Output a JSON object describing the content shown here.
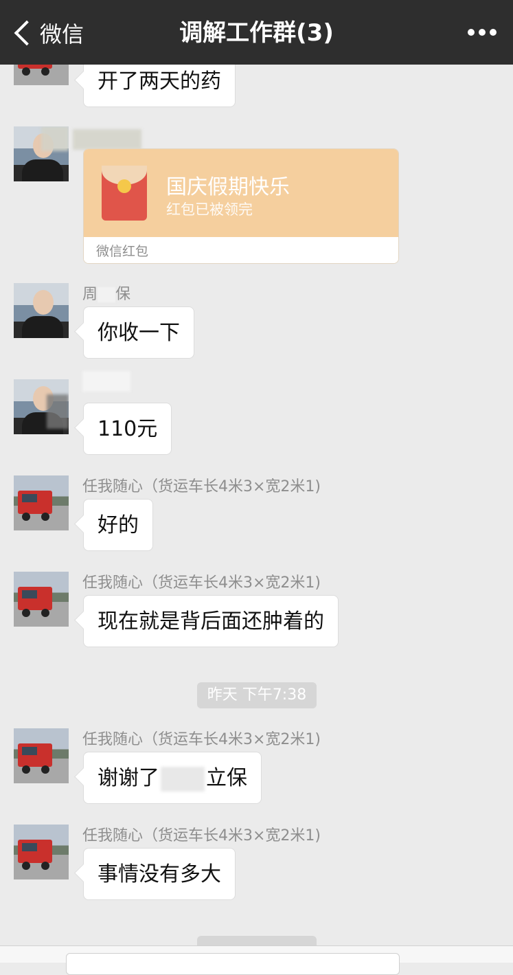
{
  "header": {
    "back_label": "微信",
    "title": "调解工作群(3)"
  },
  "messages": [
    {
      "text": "开了两天的药"
    },
    {
      "redpacket": {
        "title": "国庆假期快乐",
        "status": "红包已被领完",
        "footer": "微信红包"
      }
    },
    {
      "sender_visible": "周",
      "sender_visible_end": "保",
      "text": "你收一下"
    },
    {
      "text": "110元"
    },
    {
      "sender": "任我随心（货运车长4米3×宽2米1)",
      "text": "好的"
    },
    {
      "sender": "任我随心（货运车长4米3×宽2米1)",
      "text": "现在就是背后面还肿着的"
    },
    {
      "sender": "任我随心（货运车长4米3×宽2米1)",
      "text": "谢谢了",
      "text_end": "立保"
    },
    {
      "sender": "任我随心（货运车长4米3×宽2米1)",
      "text": "事情没有多大"
    }
  ],
  "timestamp": "昨天 下午7:38"
}
